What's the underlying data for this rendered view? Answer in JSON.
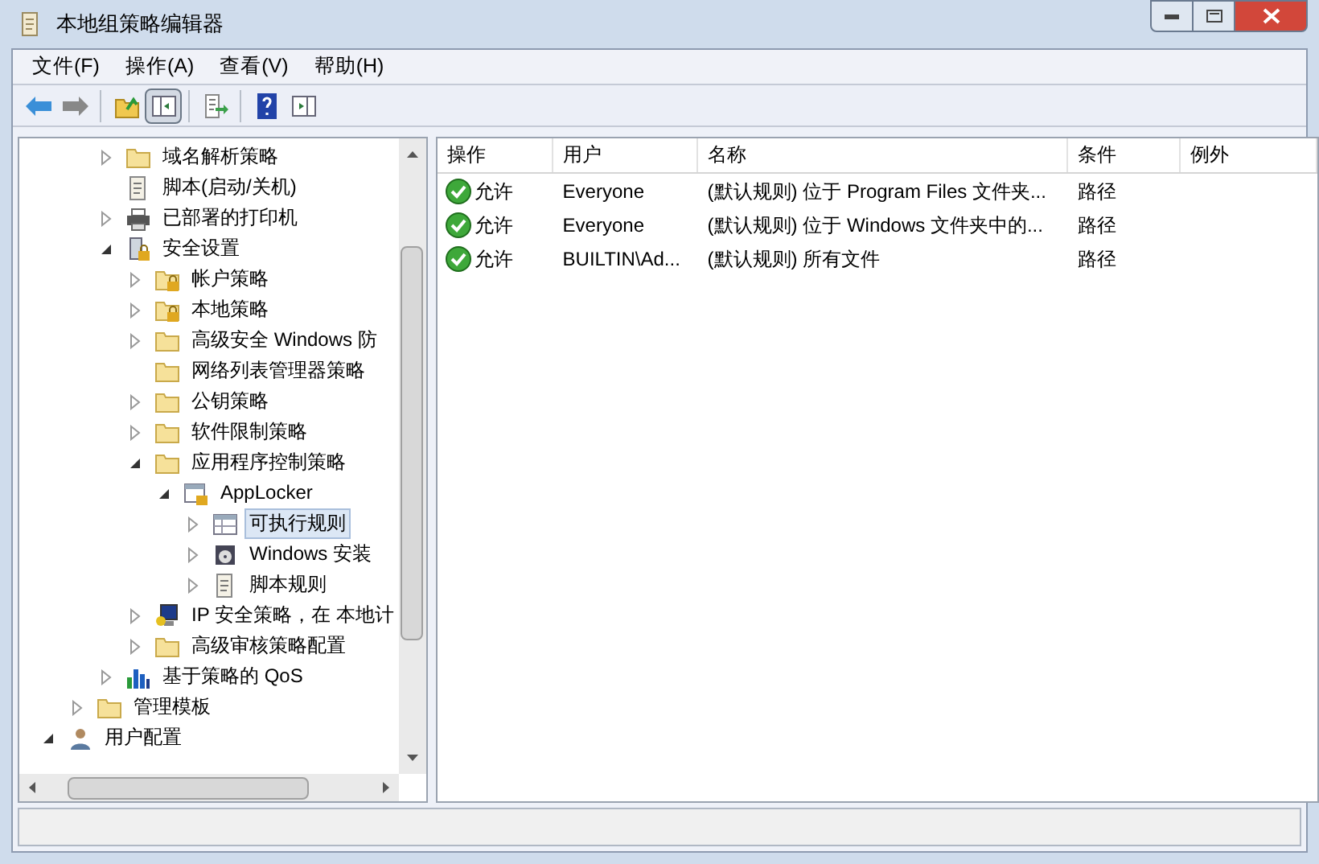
{
  "window": {
    "title": "本地组策略编辑器"
  },
  "menu": [
    "文件(F)",
    "操作(A)",
    "查看(V)",
    "帮助(H)"
  ],
  "toolbar": [
    [
      {
        "kind": "back",
        "selected": false
      },
      {
        "kind": "forward",
        "selected": false
      }
    ],
    [
      {
        "kind": "up",
        "selected": false
      },
      {
        "kind": "tree",
        "selected": true
      }
    ],
    [
      {
        "kind": "export",
        "selected": false
      }
    ],
    [
      {
        "kind": "help",
        "selected": false
      },
      {
        "kind": "pane",
        "selected": false
      }
    ]
  ],
  "tree": [
    {
      "children": [
        {
          "children": [
            {
              "label": "域名解析策略",
              "kind": "folder",
              "expanded": false,
              "selected": false
            },
            {
              "label": "脚本(启动/关机)",
              "kind": "script",
              "selected": false
            },
            {
              "label": "已部署的打印机",
              "kind": "printer",
              "expanded": false,
              "selected": false
            },
            {
              "label": "安全设置",
              "kind": "security",
              "expanded": true,
              "selected": false,
              "children": [
                {
                  "label": "帐户策略",
                  "kind": "folder-lock",
                  "expanded": false,
                  "selected": false
                },
                {
                  "label": "本地策略",
                  "kind": "folder-lock",
                  "expanded": false,
                  "selected": false
                },
                {
                  "label": "高级安全 Windows 防",
                  "kind": "folder",
                  "expanded": false,
                  "selected": false
                },
                {
                  "label": "网络列表管理器策略",
                  "kind": "folder",
                  "selected": false
                },
                {
                  "label": "公钥策略",
                  "kind": "folder",
                  "expanded": false,
                  "selected": false
                },
                {
                  "label": "软件限制策略",
                  "kind": "folder",
                  "expanded": false,
                  "selected": false
                },
                {
                  "label": "应用程序控制策略",
                  "kind": "folder",
                  "expanded": true,
                  "selected": false,
                  "children": [
                    {
                      "label": "AppLocker",
                      "kind": "applocker",
                      "expanded": true,
                      "selected": false,
                      "children": [
                        {
                          "label": "可执行规则",
                          "kind": "rules",
                          "expanded": false,
                          "selected": true
                        },
                        {
                          "label": "Windows 安装",
                          "kind": "installer",
                          "expanded": false,
                          "selected": false
                        },
                        {
                          "label": "脚本规则",
                          "kind": "script",
                          "expanded": false,
                          "selected": false
                        }
                      ]
                    }
                  ]
                },
                {
                  "label": "IP 安全策略，在 本地计",
                  "kind": "ip",
                  "expanded": false,
                  "selected": false
                },
                {
                  "label": "高级审核策略配置",
                  "kind": "folder",
                  "expanded": false,
                  "selected": false
                }
              ]
            },
            {
              "label": "基于策略的 QoS",
              "kind": "qos",
              "expanded": false,
              "selected": false
            }
          ]
        },
        {
          "label": "管理模板",
          "kind": "folder",
          "expanded": false,
          "selected": false
        }
      ]
    },
    {
      "label": "用户配置",
      "kind": "user",
      "expanded": true,
      "selected": false
    }
  ],
  "table": {
    "columns": [
      "操作",
      "用户",
      "名称",
      "条件",
      "例外"
    ],
    "rows": [
      {
        "action": "允许",
        "user": "Everyone",
        "name": "(默认规则) 位于 Program Files 文件夹...",
        "condition": "路径"
      },
      {
        "action": "允许",
        "user": "Everyone",
        "name": "(默认规则) 位于 Windows 文件夹中的...",
        "condition": "路径"
      },
      {
        "action": "允许",
        "user": "BUILTIN\\Ad...",
        "name": "(默认规则) 所有文件",
        "condition": "路径"
      }
    ]
  }
}
